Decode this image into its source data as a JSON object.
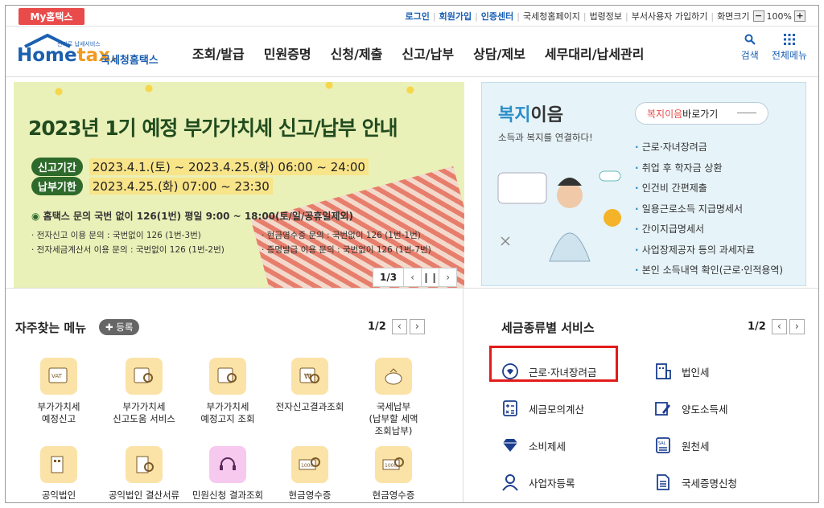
{
  "topbar": {
    "my_home": "My홈택스",
    "links": [
      "로그인",
      "회원가입",
      "인증센터",
      "국세청홈페이지",
      "법령정보",
      "부서사용자 가입하기",
      "화면크기"
    ],
    "zoom_value": "100%"
  },
  "header": {
    "logo_text_a": "Home",
    "logo_text_b": "tax.",
    "logo_tag": "전자로 납세서비스",
    "logo_sub": "국세청홈택스",
    "nav": [
      "조회/발급",
      "민원증명",
      "신청/제출",
      "신고/납부",
      "상담/제보",
      "세무대리/납세관리"
    ],
    "search_label": "검색",
    "menu_label": "전체메뉴"
  },
  "banner": {
    "title": "2023년 1기 예정 부가가치세 신고/납부 안내",
    "period_label": "신고기간",
    "period_value": "2023.4.1.(토) ~ 2023.4.25.(화) 06:00 ~ 24:00",
    "deadline_label": "납부기한",
    "deadline_value": "2023.4.25.(화) 07:00 ~ 23:30",
    "info": "홈택스 문의 국번 없이 126(1번) 평일 9:00 ~ 18:00(토/일/공휴일제외)",
    "details": [
      "· 전자신고 이용 문의 : 국번없이 126 (1번-3번)",
      "· 현금영수증 문의 : 국번없이 126 (1번-1번)",
      "· 전자세금계산서 이용 문의 : 국번없이 126 (1번-2번)",
      "· 증명발급 이용 문의 : 국번없이 126 (1번-7번)"
    ],
    "page": "1/3"
  },
  "welfare": {
    "title_a": "복지",
    "title_b": "이음",
    "subtitle": "소득과 복지를 연결하다!",
    "button_a": "복지이음",
    "button_b": " 바로가기",
    "items": [
      "근로·자녀장려금",
      "취업 후 학자금 상환",
      "인건비 간편제출",
      "일용근로소득 지급명세서",
      "간이지급명세서",
      "사업장제공자 등의 과세자료",
      "본인 소득내역 확인(근로·인적용역)"
    ]
  },
  "favorites": {
    "title": "자주찾는 메뉴",
    "register": "등록",
    "page": "1/2",
    "items": [
      "부가가치세\n예정신고",
      "부가가치세\n신고도움 서비스",
      "부가가치세\n예정고지 조회",
      "전자신고결과조회",
      "국세납부\n(납부할 세액\n조회납부)",
      "공익법인",
      "공익법인 결산서류",
      "민원신청 결과조회",
      "현금영수증",
      "현금영수증"
    ]
  },
  "tax_services": {
    "title": "세금종류별 서비스",
    "page": "1/2",
    "items": [
      "근로·자녀장려금",
      "법인세",
      "세금모의계산",
      "양도소득세",
      "소비제세",
      "원천세",
      "사업자등록",
      "국세증명신청"
    ]
  },
  "colors": {
    "accent": "#1a5fb4",
    "red": "#e21b1b",
    "banner_bg": "#e9f1b8",
    "welfare_bg": "#e6f3f8"
  }
}
